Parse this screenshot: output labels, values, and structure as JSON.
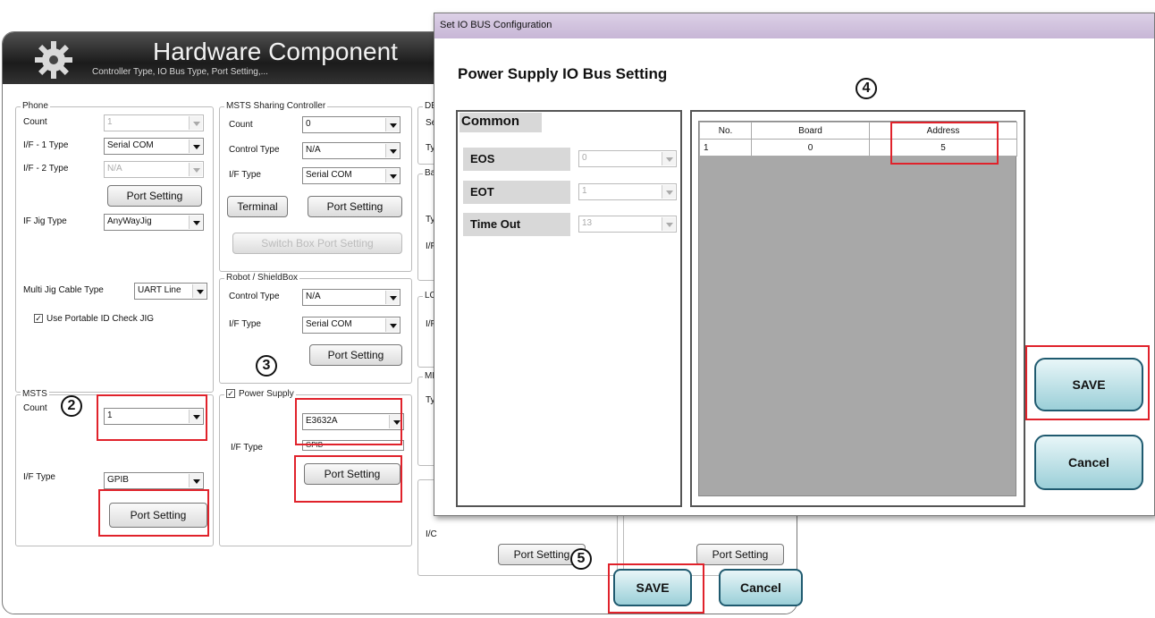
{
  "main": {
    "title": "Hardware Component",
    "subtitle": "Controller Type, IO Bus Type, Port Setting,...",
    "phone": {
      "group": "Phone",
      "count_label": "Count",
      "count": "1",
      "if1_label": "I/F - 1 Type",
      "if1": "Serial COM",
      "if2_label": "I/F - 2 Type",
      "if2": "N/A",
      "port_btn": "Port Setting",
      "jig_label": "IF Jig Type",
      "jig": "AnyWayJig",
      "multi_label": "Multi Jig Cable Type",
      "multi": "UART Line",
      "portable": "Use Portable ID Check JIG"
    },
    "msts": {
      "group": "MSTS",
      "count_label": "Count",
      "count": "1",
      "if_label": "I/F Type",
      "if": "GPIB",
      "port_btn": "Port Setting"
    },
    "sharing": {
      "group": "MSTS Sharing Controller",
      "count_label": "Count",
      "count": "0",
      "ctrl_label": "Control Type",
      "ctrl": "N/A",
      "if_label": "I/F Type",
      "if": "Serial COM",
      "terminal_btn": "Terminal",
      "port_btn": "Port Setting",
      "switch_btn": "Switch Box Port Setting"
    },
    "robot": {
      "group": "Robot / ShieldBox",
      "ctrl_label": "Control Type",
      "ctrl": "N/A",
      "if_label": "I/F Type",
      "if": "Serial COM",
      "port_btn": "Port Setting"
    },
    "power": {
      "group": "Power Supply",
      "model": "E3632A",
      "if_label": "I/F Type",
      "if": "GPIB",
      "port_btn": "Port Setting"
    },
    "partial": {
      "de": "DE",
      "se": "Se",
      "ty": "Ty",
      "ba": "Ba",
      "ty2": "Ty",
      "if1": "I/F",
      "lc": "LC",
      "if2": "I/F",
      "me": "ME",
      "ty3": "Ty",
      "ifc": "I/C"
    },
    "bottom_port1": "Port Setting",
    "bottom_port2": "Port Setting",
    "save": "SAVE",
    "cancel": "Cancel"
  },
  "dialog": {
    "title": "Set IO BUS Configuration",
    "heading": "Power Supply IO Bus Setting",
    "common": "Common",
    "rows": [
      {
        "label": "EOS",
        "value": "0"
      },
      {
        "label": "EOT",
        "value": "1"
      },
      {
        "label": "Time Out",
        "value": "13"
      }
    ],
    "table": {
      "headers": [
        "No.",
        "Board",
        "Address"
      ],
      "rows": [
        [
          "1",
          "0",
          "5"
        ]
      ]
    },
    "save": "SAVE",
    "cancel": "Cancel"
  },
  "callouts": [
    "2",
    "3",
    "4",
    "5"
  ],
  "colors": {
    "highlight": "#e0222b",
    "header_bg": "#2a2a2a",
    "dialog_bar": "#c7b6d6",
    "button_teal": "#9bcfd8"
  }
}
